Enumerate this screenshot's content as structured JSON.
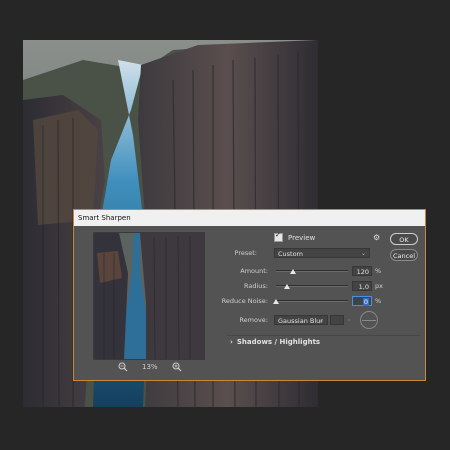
{
  "dialog": {
    "title": "Smart Sharpen",
    "preview_label": "Preview",
    "preview_checked": true,
    "preset_label": "Preset:",
    "preset_value": "Custom",
    "amount_label": "Amount:",
    "amount_value": "120",
    "amount_unit": "%",
    "amount_fraction": 0.24,
    "radius_label": "Radius:",
    "radius_value": "1,0",
    "radius_unit": "px",
    "radius_fraction": 0.15,
    "noise_label": "Reduce Noise:",
    "noise_value": "0",
    "noise_unit": "%",
    "noise_fraction": 0.0,
    "remove_label": "Remove:",
    "remove_value": "Gaussian Blur",
    "angle_degree_symbol": "°",
    "zoom_level": "13%",
    "section_label": "Shadows / Highlights",
    "ok_label": "OK",
    "cancel_label": "Cancel"
  },
  "icons": {
    "gear": "gear-icon",
    "zoom_out": "zoom-out-icon",
    "zoom_in": "zoom-in-icon",
    "chevron": "chevron-right-icon",
    "checkbox": "check-icon"
  },
  "colors": {
    "dialog_bg": "#535353",
    "focus_border": "#c8873c",
    "app_bg": "#262626",
    "water": "#2a6a8c"
  }
}
